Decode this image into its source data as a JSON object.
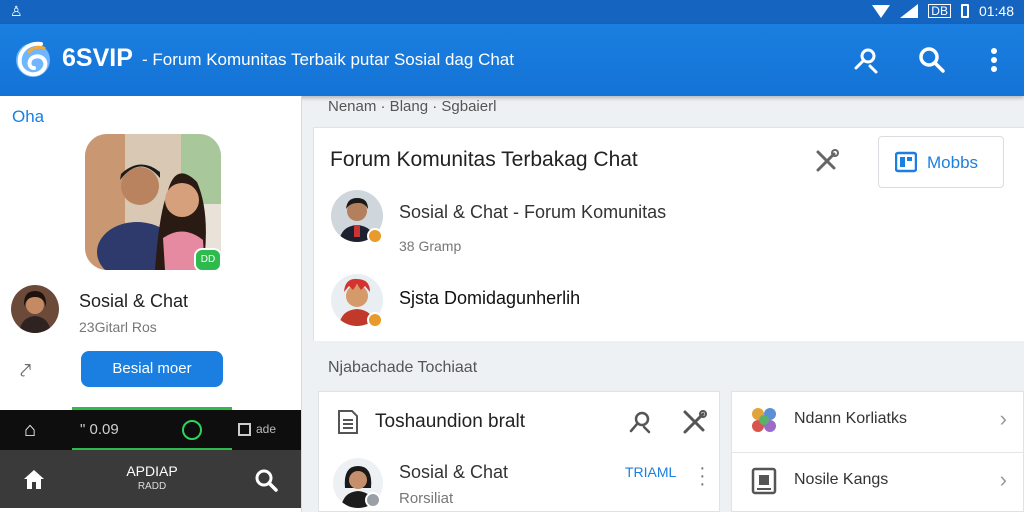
{
  "status_bar": {
    "left_icon": "accessibility-icon",
    "box_label": "DB",
    "time": "01:48"
  },
  "app_bar": {
    "brand": "6SVIP",
    "subtitle": "- Forum Komunitas Terbaik putar Sosial dag Chat",
    "actions": [
      "search-person-icon",
      "search-icon",
      "more-vert-icon"
    ]
  },
  "sidebar": {
    "title": "Oha",
    "photo_badge": "DD",
    "profile": {
      "name": "Sosial & Chat",
      "meta": "23Gitarl Ros"
    },
    "button_label": "Besial moer"
  },
  "player": {
    "time": "\" 0.09",
    "right_label": "ade"
  },
  "bottom_nav": {
    "center_label": "APDIAP",
    "center_sub": "RADD"
  },
  "main": {
    "breadcrumb": "Nenam · Blang · Sgbaierl",
    "card": {
      "title": "Forum Komunitas Terbakag Chat",
      "button_label": "Mobbs",
      "rows": [
        {
          "title": "Sosial & Chat - Forum Komunitas",
          "sub": "38 Gramp"
        },
        {
          "title": "Sjsta Domidagunherlih",
          "sub": ""
        }
      ]
    },
    "section_title": "Njabachade Tochiaat",
    "thread_card": {
      "title": "Toshaundion bralt",
      "item_title": "Sosial & Chat",
      "item_sub": "Rorsiliat",
      "tab_link": "TRIAML"
    },
    "links": [
      {
        "label": "Ndann Korliatks"
      },
      {
        "label": "Nosile Kangs"
      }
    ]
  },
  "colors": {
    "primary": "#1a7fe0",
    "status_bar": "#1565c0",
    "accent_green": "#2dbb4d"
  }
}
